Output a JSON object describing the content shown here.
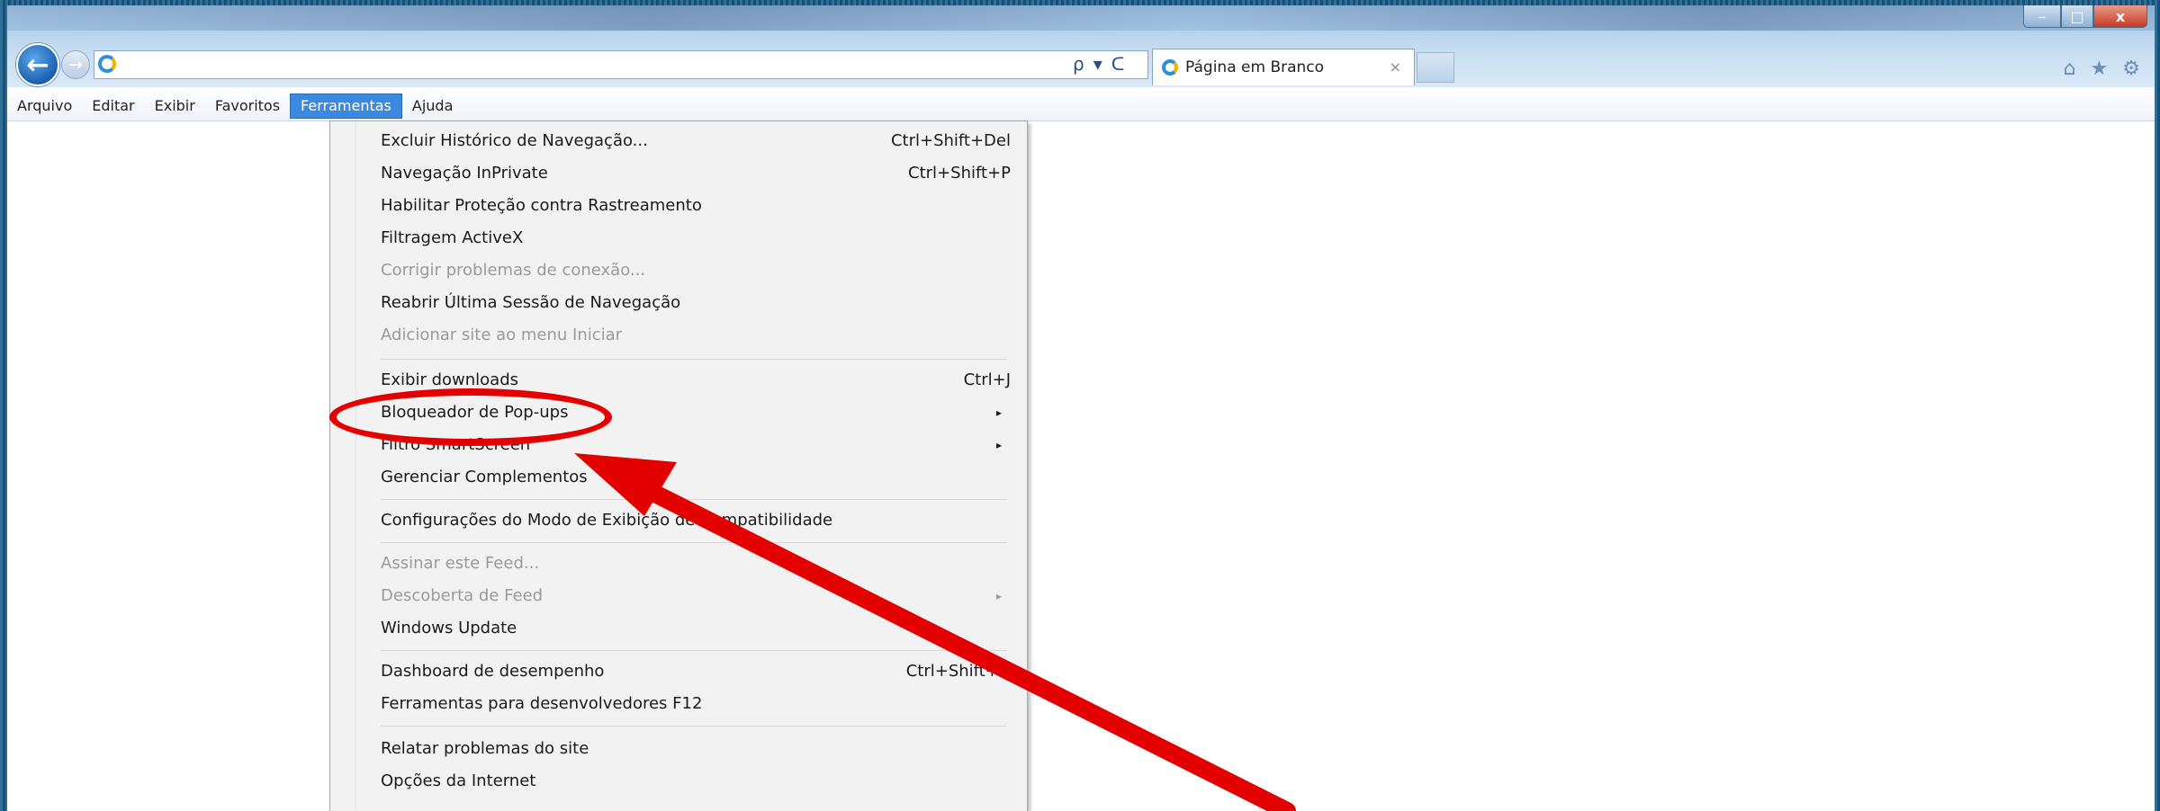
{
  "window": {
    "controls": {
      "minimize": "–",
      "maximize": "□",
      "close": "x"
    }
  },
  "nav": {
    "back_icon": "arrow-left-icon",
    "forward_icon": "arrow-right-icon",
    "address_value": "",
    "search_symbol": "ρ",
    "dropdown_symbol": "▾",
    "refresh_symbol": "ᑕ"
  },
  "tab": {
    "title": "Página em Branco",
    "close": "×"
  },
  "toolbar_icons": {
    "home": "⌂",
    "favorites": "★",
    "settings": "⚙"
  },
  "menubar": {
    "items": [
      "Arquivo",
      "Editar",
      "Exibir",
      "Favoritos",
      "Ferramentas",
      "Ajuda"
    ],
    "active": "Ferramentas"
  },
  "tools_menu": {
    "items": [
      {
        "label": "Excluir Histórico de Navegação...",
        "shortcut": "Ctrl+Shift+Del",
        "enabled": true
      },
      {
        "label": "Navegação InPrivate",
        "shortcut": "Ctrl+Shift+P",
        "enabled": true
      },
      {
        "label": "Habilitar Proteção contra Rastreamento",
        "shortcut": "",
        "enabled": true
      },
      {
        "label": "Filtragem ActiveX",
        "shortcut": "",
        "enabled": true
      },
      {
        "label": "Corrigir problemas de conexão...",
        "shortcut": "",
        "enabled": false
      },
      {
        "label": "Reabrir Última Sessão de Navegação",
        "shortcut": "",
        "enabled": true
      },
      {
        "label": "Adicionar site ao menu Iniciar",
        "shortcut": "",
        "enabled": false
      },
      {
        "label": "Exibir downloads",
        "shortcut": "Ctrl+J",
        "enabled": true
      },
      {
        "label": "Bloqueador de Pop-ups",
        "shortcut": "",
        "enabled": true,
        "submenu": true
      },
      {
        "label": "Filtro SmartScreen",
        "shortcut": "",
        "enabled": true,
        "submenu": true
      },
      {
        "label": "Gerenciar Complementos",
        "shortcut": "",
        "enabled": true
      },
      {
        "label": "Configurações do Modo de Exibição de Compatibilidade",
        "shortcut": "",
        "enabled": true
      },
      {
        "label": "Assinar este Feed...",
        "shortcut": "",
        "enabled": false
      },
      {
        "label": "Descoberta de Feed",
        "shortcut": "",
        "enabled": false,
        "submenu": true
      },
      {
        "label": "Windows Update",
        "shortcut": "",
        "enabled": true
      },
      {
        "label": "Dashboard de desempenho",
        "shortcut": "Ctrl+Shift+U",
        "enabled": true
      },
      {
        "label": "Ferramentas para desenvolvedores F12",
        "shortcut": "",
        "enabled": true
      },
      {
        "label": "Relatar problemas do site",
        "shortcut": "",
        "enabled": true
      },
      {
        "label": "Opções da Internet",
        "shortcut": "",
        "enabled": true
      }
    ],
    "submenu_arrow": "▸"
  },
  "annotation": {
    "color": "#e30000",
    "highlighted_item": "Bloqueador de Pop-ups"
  }
}
